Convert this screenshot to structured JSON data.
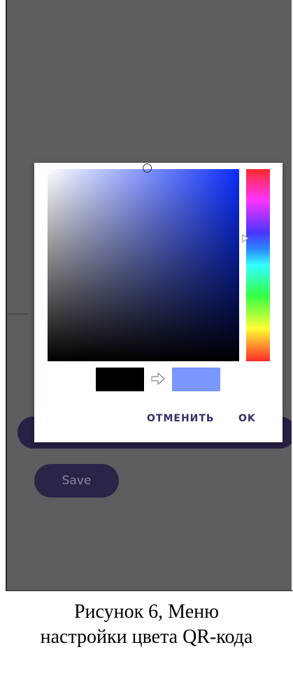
{
  "dialog": {
    "cancel_label": "ОТМЕНИТЬ",
    "ok_label": "OK",
    "old_color": "#000000",
    "new_color": "#7a96ff",
    "hue_color": "#0a2dff"
  },
  "form": {
    "save_label": "Save"
  },
  "caption": {
    "line1": "Рисунок 6, Меню",
    "line2": "настройки цвета QR-кода"
  },
  "colors": {
    "scrim": "#5f5d60",
    "accent": "#2c2447",
    "button_text": "#3a2e66"
  },
  "icons": {
    "arrow": "arrow-right-outline-icon",
    "sv_cursor": "circle-cursor-icon",
    "hue_handle": "triangle-pointer-icon"
  }
}
